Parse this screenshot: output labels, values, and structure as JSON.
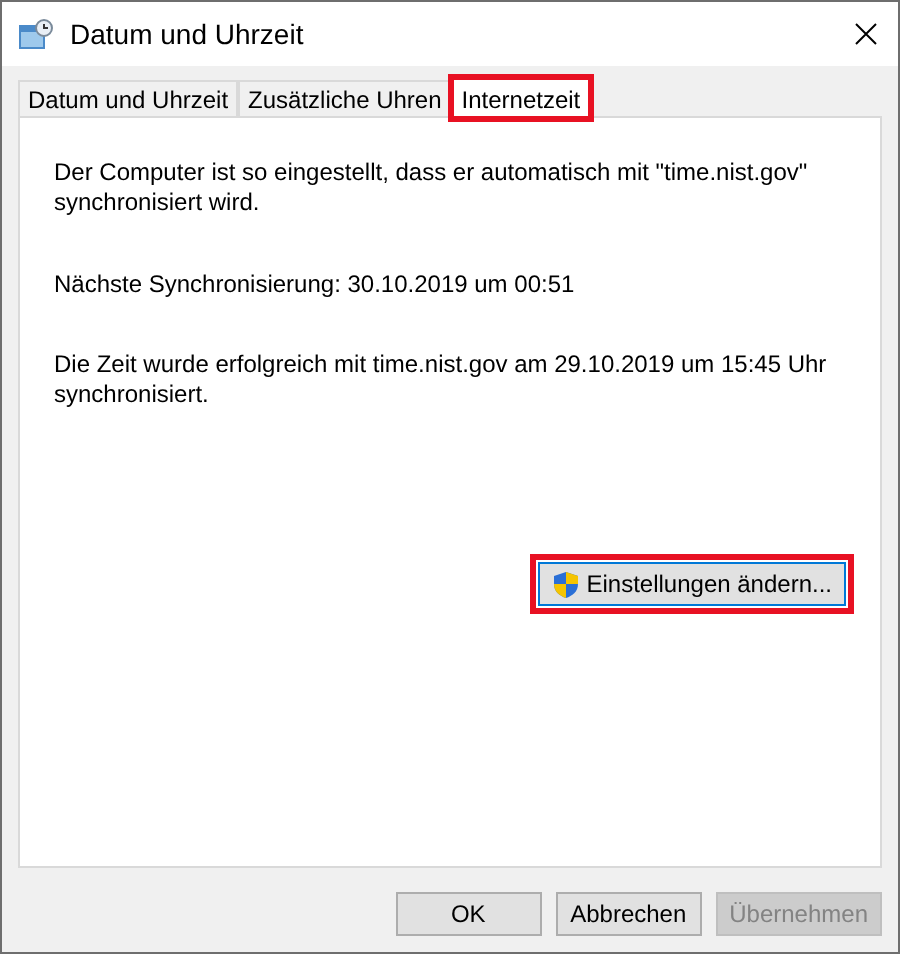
{
  "window": {
    "title": "Datum und Uhrzeit"
  },
  "tabs": [
    {
      "label": "Datum und Uhrzeit",
      "selected": false,
      "highlighted": false
    },
    {
      "label": "Zusätzliche Uhren",
      "selected": false,
      "highlighted": false
    },
    {
      "label": "Internetzeit",
      "selected": true,
      "highlighted": true
    }
  ],
  "panel": {
    "paragraphs": [
      "Der Computer ist so eingestellt, dass er automatisch mit \"time.nist.gov\" synchronisiert wird.",
      "Nächste Synchronisierung: 30.10.2019 um 00:51",
      "Die Zeit wurde erfolgreich mit time.nist.gov am 29.10.2019 um 15:45 Uhr synchronisiert."
    ],
    "settings_button": {
      "label": "Einstellungen ändern...",
      "highlighted": true
    }
  },
  "buttons": [
    {
      "label": "OK",
      "disabled": false
    },
    {
      "label": "Abbrechen",
      "disabled": false
    },
    {
      "label": "Übernehmen",
      "disabled": true
    }
  ]
}
